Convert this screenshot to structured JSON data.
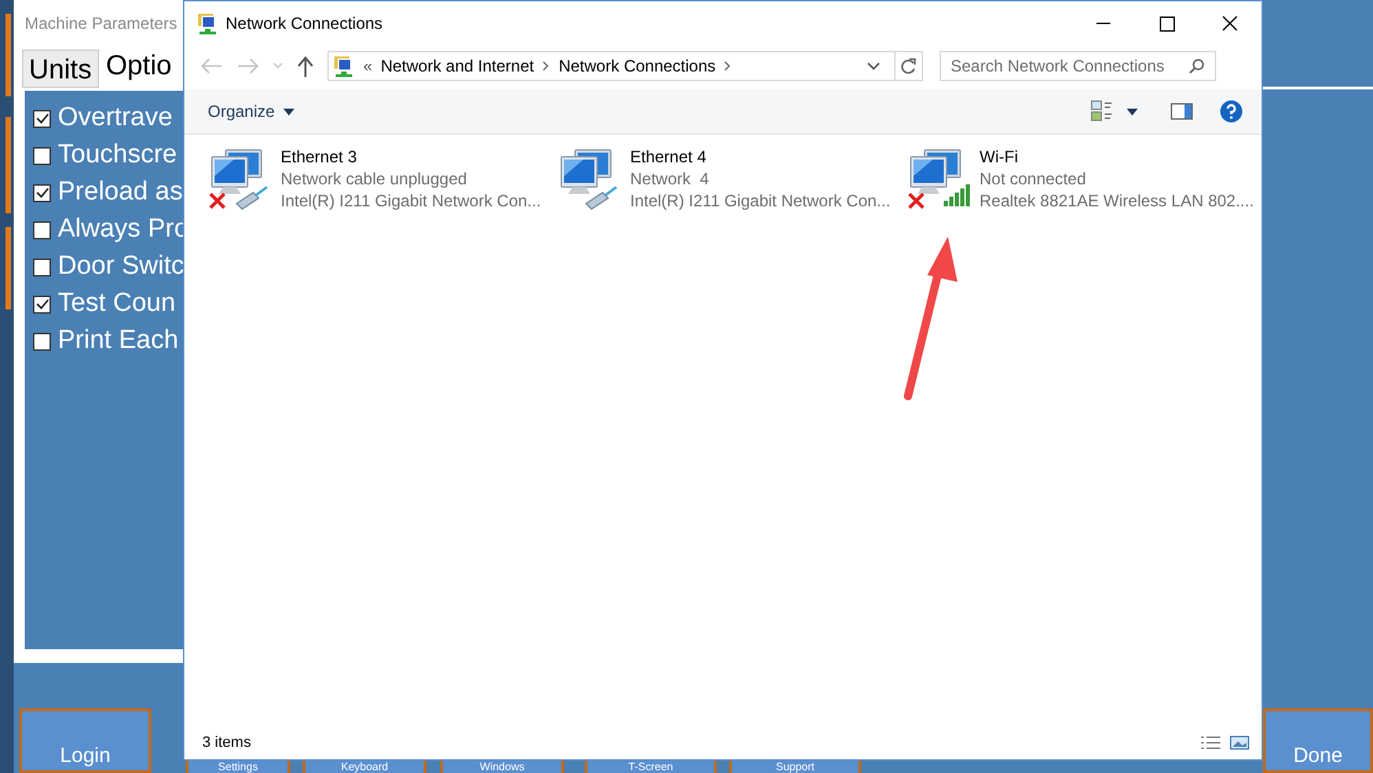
{
  "background_app": {
    "title": "Machine Parameters",
    "tabs": [
      {
        "label": "Units",
        "selected": false
      },
      {
        "label": "Optio",
        "selected": true
      }
    ],
    "options": [
      {
        "label": "Overtrave",
        "checked": true
      },
      {
        "label": "Touchscre",
        "checked": false
      },
      {
        "label": "Preload as",
        "checked": true
      },
      {
        "label": "Always Pro",
        "checked": false
      },
      {
        "label": "Door Switc",
        "checked": false
      },
      {
        "label": "Test Coun",
        "checked": true
      },
      {
        "label": "Print Each",
        "checked": false
      }
    ],
    "buttons": [
      {
        "label": "Login",
        "kind": "full"
      },
      {
        "label": "Settings",
        "kind": "hidden"
      },
      {
        "label": "Keyboard",
        "kind": "hidden"
      },
      {
        "label": "Windows",
        "kind": "hidden"
      },
      {
        "label": "T-Screen",
        "kind": "hidden"
      },
      {
        "label": "Support",
        "kind": "hidden"
      },
      {
        "label": "Done",
        "kind": "full"
      }
    ]
  },
  "window": {
    "title": "Network Connections",
    "breadcrumb": [
      "«",
      "Network and Internet",
      "Network Connections"
    ],
    "search": {
      "placeholder": "Search Network Connections"
    },
    "toolbar": {
      "organize": "Organize"
    },
    "connections": [
      {
        "name": "Ethernet 3",
        "status": "Network cable unplugged",
        "adapter": "Intel(R) I211 Gigabit Network Con...",
        "kind": "ethernet",
        "disconnected": true
      },
      {
        "name": "Ethernet 4",
        "status": "Network  4",
        "adapter": "Intel(R) I211 Gigabit Network Con...",
        "kind": "ethernet",
        "disconnected": false
      },
      {
        "name": "Wi-Fi",
        "status": "Not connected",
        "adapter": "Realtek 8821AE Wireless LAN 802....",
        "kind": "wifi",
        "disconnected": true
      }
    ],
    "status_bar": "3 items"
  }
}
